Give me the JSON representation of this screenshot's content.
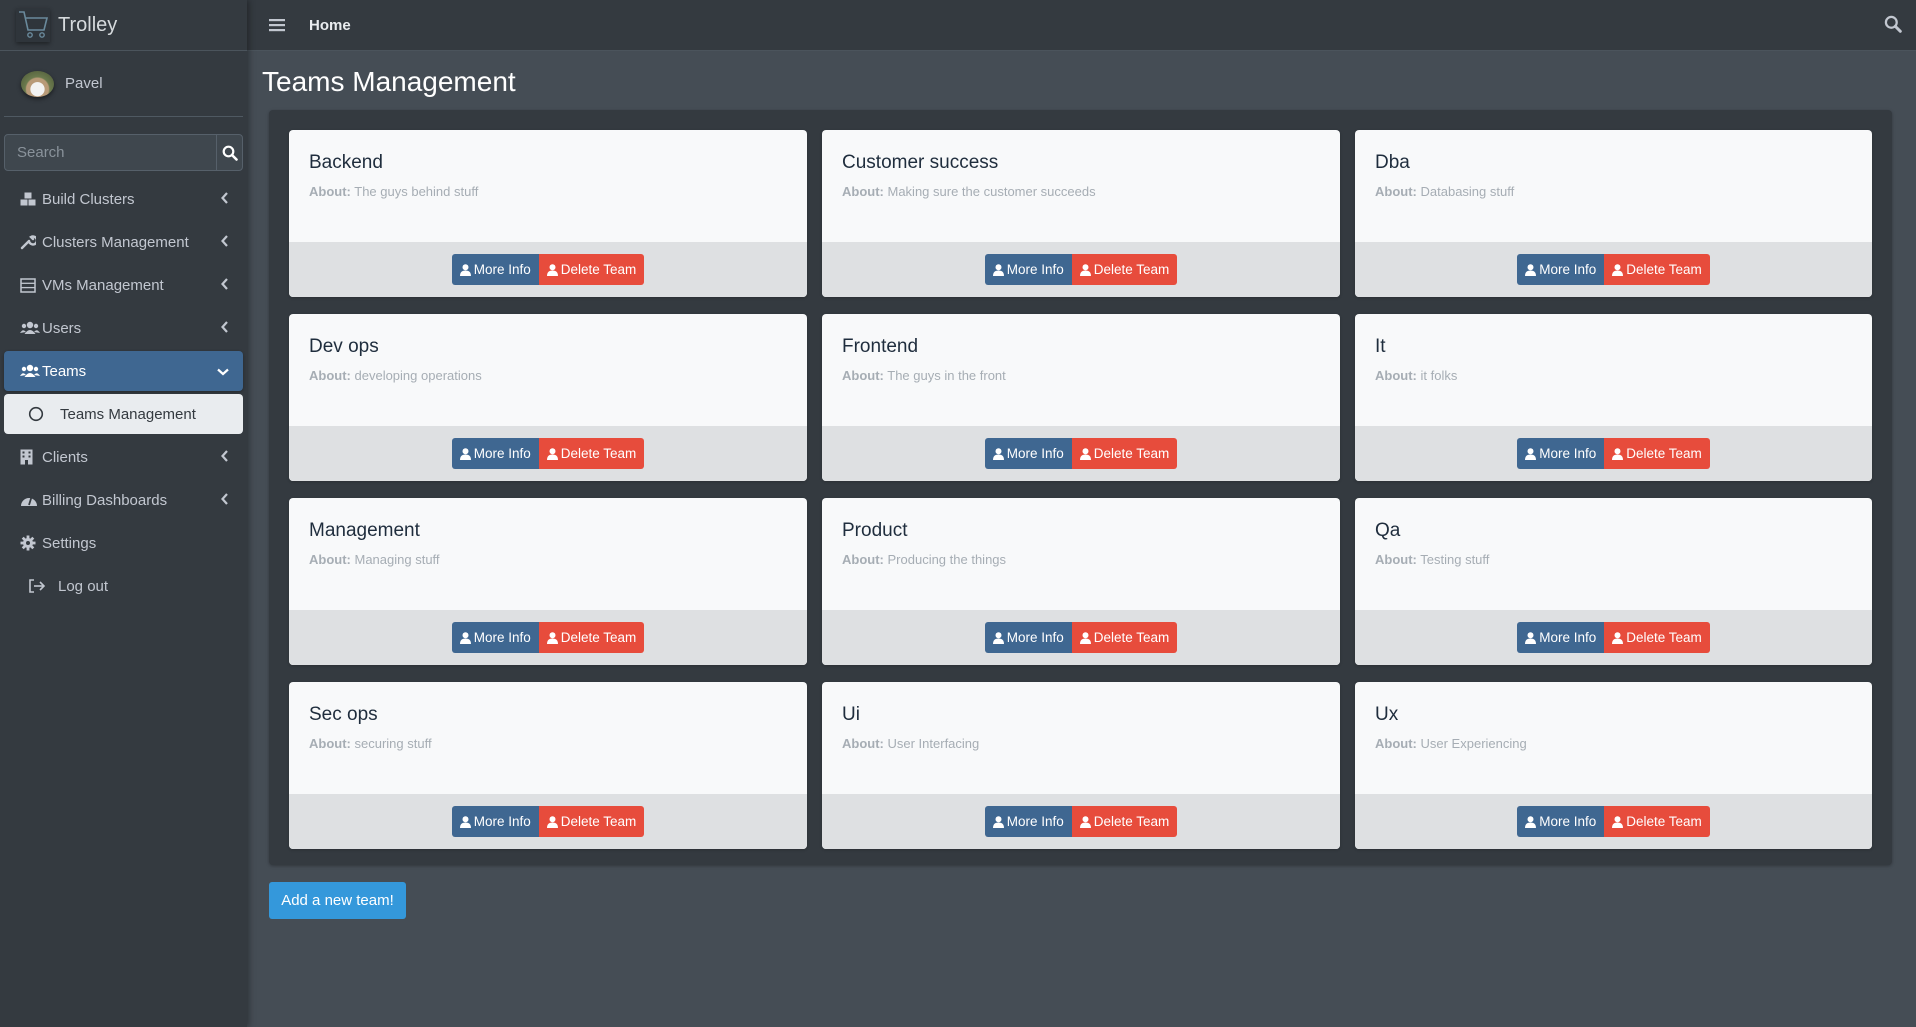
{
  "brand": {
    "name": "Trolley",
    "logo_icon": "shopping-cart-icon"
  },
  "user": {
    "name": "Pavel"
  },
  "sidebar": {
    "search_placeholder": "Search",
    "items": [
      {
        "label": "Build Clusters",
        "icon": "cubes-icon",
        "expandable": true
      },
      {
        "label": "Clusters Management",
        "icon": "wrench-icon",
        "expandable": true
      },
      {
        "label": "VMs Management",
        "icon": "server-icon",
        "expandable": true
      },
      {
        "label": "Users",
        "icon": "users-icon",
        "expandable": true
      },
      {
        "label": "Teams",
        "icon": "users-icon",
        "expandable": true,
        "active": true
      },
      {
        "label": "Teams Management",
        "icon": "circle-icon",
        "sub": true,
        "selected": true
      },
      {
        "label": "Clients",
        "icon": "building-icon",
        "expandable": true
      },
      {
        "label": "Billing Dashboards",
        "icon": "dashboard-icon",
        "expandable": true
      },
      {
        "label": "Settings",
        "icon": "gear-icon",
        "expandable": false
      },
      {
        "label": "Log out",
        "icon": "sign-out-icon",
        "expandable": false
      }
    ]
  },
  "topbar": {
    "home_label": "Home"
  },
  "page": {
    "title": "Teams Management",
    "add_button": "Add a new team!"
  },
  "card_labels": {
    "about": "About:",
    "more_info": "More Info",
    "delete": "Delete Team"
  },
  "teams": [
    {
      "name": "Backend",
      "about": "The guys behind stuff"
    },
    {
      "name": "Customer success",
      "about": "Making sure the customer succeeds"
    },
    {
      "name": "Dba",
      "about": "Databasing stuff"
    },
    {
      "name": "Dev ops",
      "about": "developing operations"
    },
    {
      "name": "Frontend",
      "about": "The guys in the front"
    },
    {
      "name": "It",
      "about": "it folks"
    },
    {
      "name": "Management",
      "about": "Managing stuff"
    },
    {
      "name": "Product",
      "about": "Producing the things"
    },
    {
      "name": "Qa",
      "about": "Testing stuff"
    },
    {
      "name": "Sec ops",
      "about": "securing stuff"
    },
    {
      "name": "Ui",
      "about": "User Interfacing"
    },
    {
      "name": "Ux",
      "about": "User Experiencing"
    }
  ],
  "colors": {
    "primary": "#3f6791",
    "danger": "#e74c3c",
    "accent": "#3498db",
    "sidebar_bg": "#343a40",
    "content_bg": "#454d55"
  }
}
